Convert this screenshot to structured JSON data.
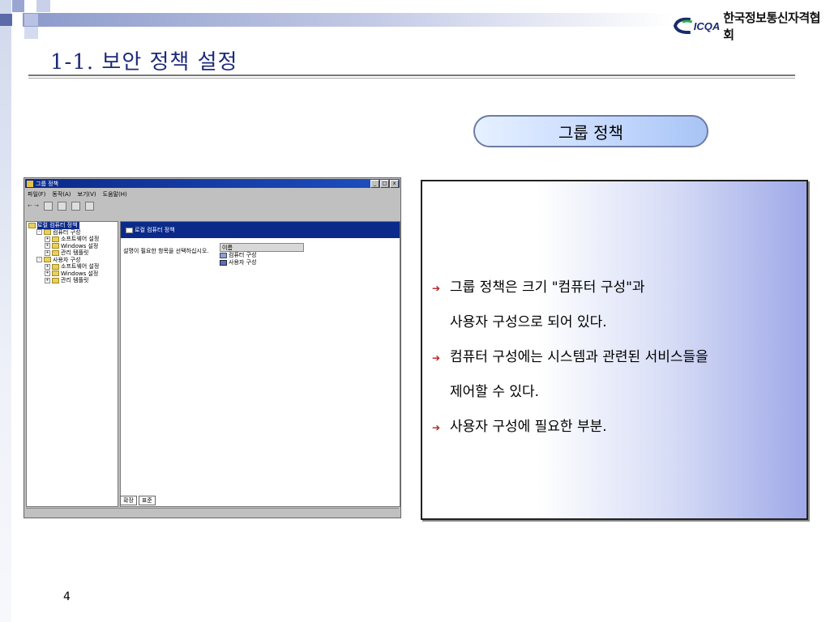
{
  "header": {
    "logo_mark": "ICQA",
    "logo_text": "한국정보통신자격협회"
  },
  "slide": {
    "title": "1-1. 보안 정책 설정",
    "pill_label": "그룹 정책",
    "page_number": "4"
  },
  "notes": [
    {
      "bullet": true,
      "text": "그룹 정책은 크기 \"컴퓨터 구성\"과"
    },
    {
      "bullet": false,
      "text": "사용자 구성으로 되어 있다."
    },
    {
      "bullet": true,
      "text": "컴퓨터 구성에는 시스템과 관련된 서비스들을"
    },
    {
      "bullet": false,
      "text": "제어할 수 있다."
    },
    {
      "bullet": true,
      "text": "사용자 구성에 필요한 부분."
    }
  ],
  "screenshot": {
    "window_title": "그룹 정책",
    "window_buttons": [
      "_",
      "□",
      "x"
    ],
    "menu": [
      "파일(F)",
      "동작(A)",
      "보기(V)",
      "도움말(H)"
    ],
    "toolbar_arrows": "← →",
    "tree": [
      {
        "label": "로컬 컴퓨터 정책",
        "level": 0,
        "selected": true
      },
      {
        "label": "컴퓨터 구성",
        "level": 1
      },
      {
        "label": "소프트웨어 설정",
        "level": 2
      },
      {
        "label": "Windows 설정",
        "level": 2
      },
      {
        "label": "관리 템플릿",
        "level": 2
      },
      {
        "label": "사용자 구성",
        "level": 1
      },
      {
        "label": "소프트웨어 설정",
        "level": 2
      },
      {
        "label": "Windows 설정",
        "level": 2
      },
      {
        "label": "관리 템플릿",
        "level": 2
      }
    ],
    "right_header": "로컬 컴퓨터 정책",
    "right_description": "설명이 필요한 항목을 선택하십시오.",
    "column_header": "이름",
    "rows": [
      "컴퓨터 구성",
      "사용자 구성"
    ],
    "tabs": [
      "확장",
      "표준"
    ]
  }
}
